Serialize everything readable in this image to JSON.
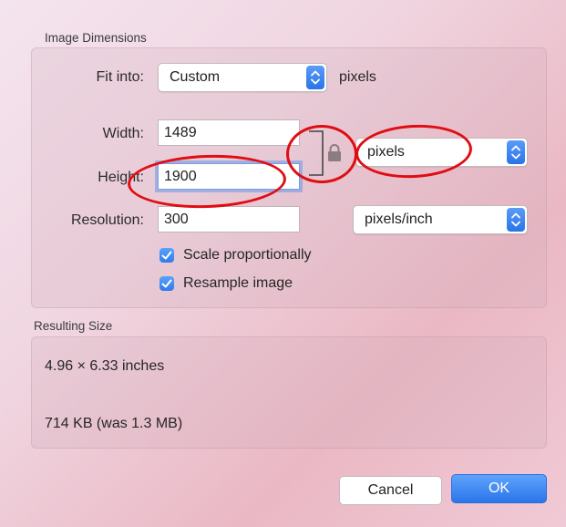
{
  "dimensions": {
    "section_title": "Image Dimensions",
    "fit_into_label": "Fit into:",
    "fit_into_value": "Custom",
    "fit_into_unit": "pixels",
    "width_label": "Width:",
    "width_value": "1489",
    "height_label": "Height:",
    "height_value": "1900",
    "resolution_label": "Resolution:",
    "resolution_value": "300",
    "size_unit_value": "pixels",
    "resolution_unit_value": "pixels/inch",
    "scale_proportionally_label": "Scale proportionally",
    "resample_image_label": "Resample image"
  },
  "result": {
    "section_title": "Resulting Size",
    "physical_size": "4.96 × 6.33 inches",
    "file_size": "714 KB (was 1.3 MB)"
  },
  "buttons": {
    "cancel": "Cancel",
    "ok": "OK"
  },
  "colors": {
    "accent": "#2f7ae9",
    "annotation": "#e00d12"
  }
}
